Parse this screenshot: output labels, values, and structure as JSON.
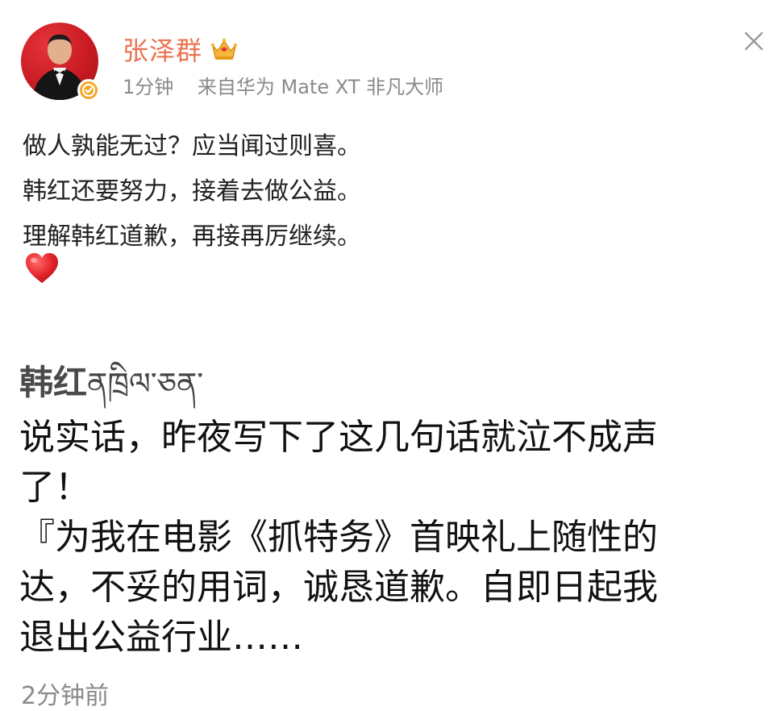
{
  "post": {
    "author": "张泽群",
    "time": "1分钟",
    "source": "来自华为 Mate XT 非凡大师",
    "content_lines": [
      "做人孰能无过？应当闻过则喜。",
      "韩红还要努力，接着去做公益。",
      "理解韩红道歉，再接再厉继续。"
    ],
    "emoji": "heart",
    "icons": {
      "avatar": "avatar",
      "verified": "verified-badge-icon",
      "crown": "crown-icon",
      "close": "close-icon"
    },
    "colors": {
      "username": "#eb7350",
      "meta": "#8a8a8a",
      "verified": "#f5a623",
      "heart": "#e5262b"
    }
  },
  "quoted_post": {
    "author": "韩红",
    "author_suffix": "ནཁྲིལ་ཅན་",
    "content_lines": [
      "说实话，昨夜写下了这几句话就泣不成声",
      "了！",
      "『为我在电影《抓特务》首映礼上随性的",
      "达，不妥的用词，诚恳道歉。自即日起我",
      "退出公益行业……"
    ],
    "time": "2分钟前"
  }
}
